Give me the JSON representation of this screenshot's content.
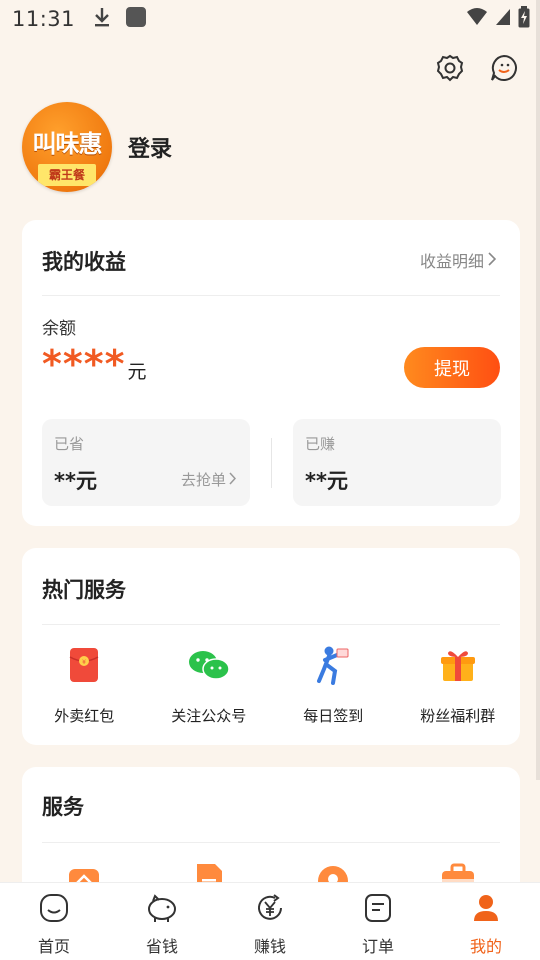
{
  "status_bar": {
    "time": "11:31"
  },
  "profile": {
    "avatar_text": "叫味惠",
    "avatar_sub": "霸王餐",
    "login_label": "登录"
  },
  "earnings": {
    "title": "我的收益",
    "detail_link": "收益明细",
    "balance_label": "余额",
    "balance_value": "****",
    "balance_unit": "元",
    "withdraw_label": "提现",
    "saved": {
      "label": "已省",
      "value": "**元",
      "link": "去抢单"
    },
    "earned": {
      "label": "已赚",
      "value": "**元"
    }
  },
  "hot_services": {
    "title": "热门服务",
    "items": [
      {
        "label": "外卖红包",
        "icon": "red-envelope-icon",
        "color": "#f04a3a"
      },
      {
        "label": "关注公众号",
        "icon": "wechat-icon",
        "color": "#2bc24b"
      },
      {
        "label": "每日签到",
        "icon": "sign-in-runner-icon",
        "color": "#3a7be0"
      },
      {
        "label": "粉丝福利群",
        "icon": "gift-icon",
        "color": "#ffb11a"
      }
    ]
  },
  "services": {
    "title": "服务"
  },
  "tabbar": {
    "tabs": [
      {
        "label": "首页",
        "icon": "home-icon",
        "active": false
      },
      {
        "label": "省钱",
        "icon": "piggy-bank-icon",
        "active": false
      },
      {
        "label": "赚钱",
        "icon": "yen-coin-icon",
        "active": false
      },
      {
        "label": "订单",
        "icon": "order-icon",
        "active": false
      },
      {
        "label": "我的",
        "icon": "profile-icon",
        "active": true
      }
    ]
  },
  "colors": {
    "accent": "#f0631a",
    "background": "#fbf4ec"
  }
}
